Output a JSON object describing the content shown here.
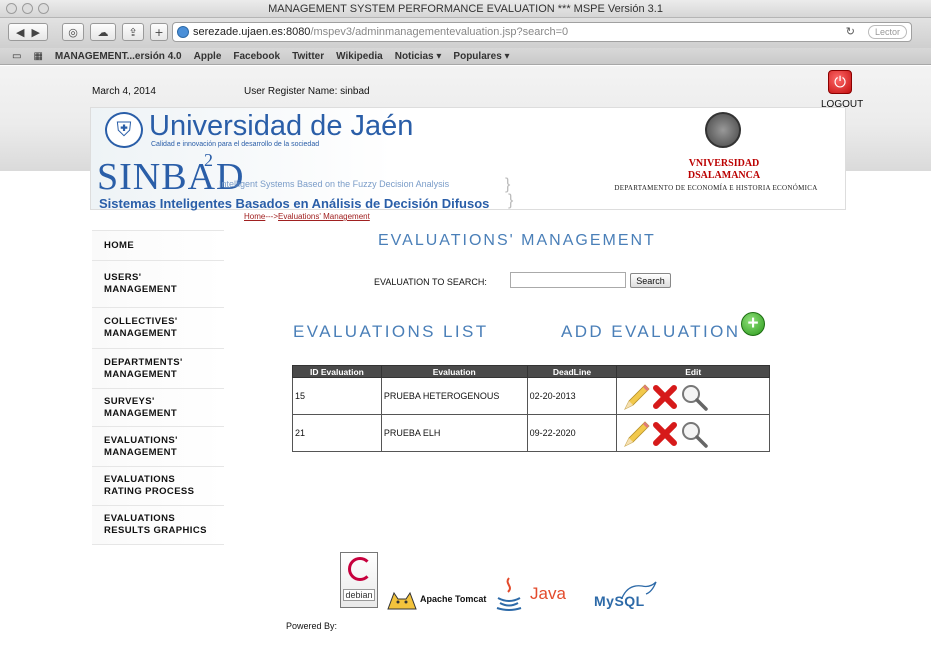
{
  "browser": {
    "window_title": "MANAGEMENT SYSTEM PERFORMANCE EVALUATION *** MSPE Versión 3.1",
    "url_host": "serezade.ujaen.es:8080",
    "url_path": "/mspev3/adminmanagementevaluation.jsp?search=0",
    "reader_label": "Lector",
    "bookmarks": [
      "MANAGEMENT...ersión 4.0",
      "Apple",
      "Facebook",
      "Twitter",
      "Wikipedia",
      "Noticias ▾",
      "Populares ▾"
    ]
  },
  "header": {
    "date": "March 4, 2014",
    "user_register": "User Register Name: sinbad",
    "logout_label": "LOGOUT"
  },
  "banner": {
    "university_name": "Universidad de Jaén",
    "university_tagline": "Calidad e innovación para el desarrollo de la sociedad",
    "project_name": "SINBAD",
    "project_sup": "2",
    "project_subtitle_en": "Intelligent Systems Based on the Fuzzy Decision Analysis",
    "project_subtitle_es": "Sistemas Inteligentes Basados en Análisis de Decisión Difusos",
    "partner_line1": "VNIVERSIDAD",
    "partner_line2": "DSALAMANCA",
    "partner_dept": "DEPARTAMENTO DE ECONOMÍA E HISTORIA ECONÓMICA"
  },
  "breadcrumb": {
    "home": "Home",
    "separator": "--->",
    "current": "Evaluations' Management"
  },
  "sidebar": {
    "items": [
      {
        "line1": "HOME",
        "line2": ""
      },
      {
        "line1": "USERS'",
        "line2": "MANAGEMENT"
      },
      {
        "line1": "COLLECTIVES'",
        "line2": "MANAGEMENT"
      },
      {
        "line1": "DEPARTMENTS'",
        "line2": "MANAGEMENT"
      },
      {
        "line1": "SURVEYS'",
        "line2": "MANAGEMENT"
      },
      {
        "line1": "EVALUATIONS'",
        "line2": "MANAGEMENT"
      },
      {
        "line1": "EVALUATIONS",
        "line2": "RATING PROCESS"
      },
      {
        "line1": "EVALUATIONS",
        "line2": "RESULTS GRAPHICS"
      }
    ]
  },
  "main": {
    "title": "EVALUATIONS' MANAGEMENT",
    "search_label": "EVALUATION TO SEARCH:",
    "search_value": "",
    "search_button": "Search",
    "list_title": "EVALUATIONS LIST",
    "add_title": "ADD EVALUATION",
    "table": {
      "headers": [
        "ID Evaluation",
        "Evaluation",
        "DeadLine",
        "Edit"
      ],
      "rows": [
        {
          "id": "15",
          "name": "PRUEBA HETEROGENOUS",
          "deadline": "02-20-2013"
        },
        {
          "id": "21",
          "name": "PRUEBA ELH",
          "deadline": "09-22-2020"
        }
      ]
    }
  },
  "footer": {
    "powered_by": "Powered By:",
    "debian_label": "debian",
    "tomcat_label": "Apache Tomcat",
    "java_label": "Java",
    "mysql_label": "MySQL"
  },
  "colors": {
    "accent": "#4a7fb8",
    "breadcrumb": "#a02020",
    "table_header": "#4a4a4a",
    "delete_red": "#d61a1a",
    "add_green": "#2a9a1a"
  }
}
